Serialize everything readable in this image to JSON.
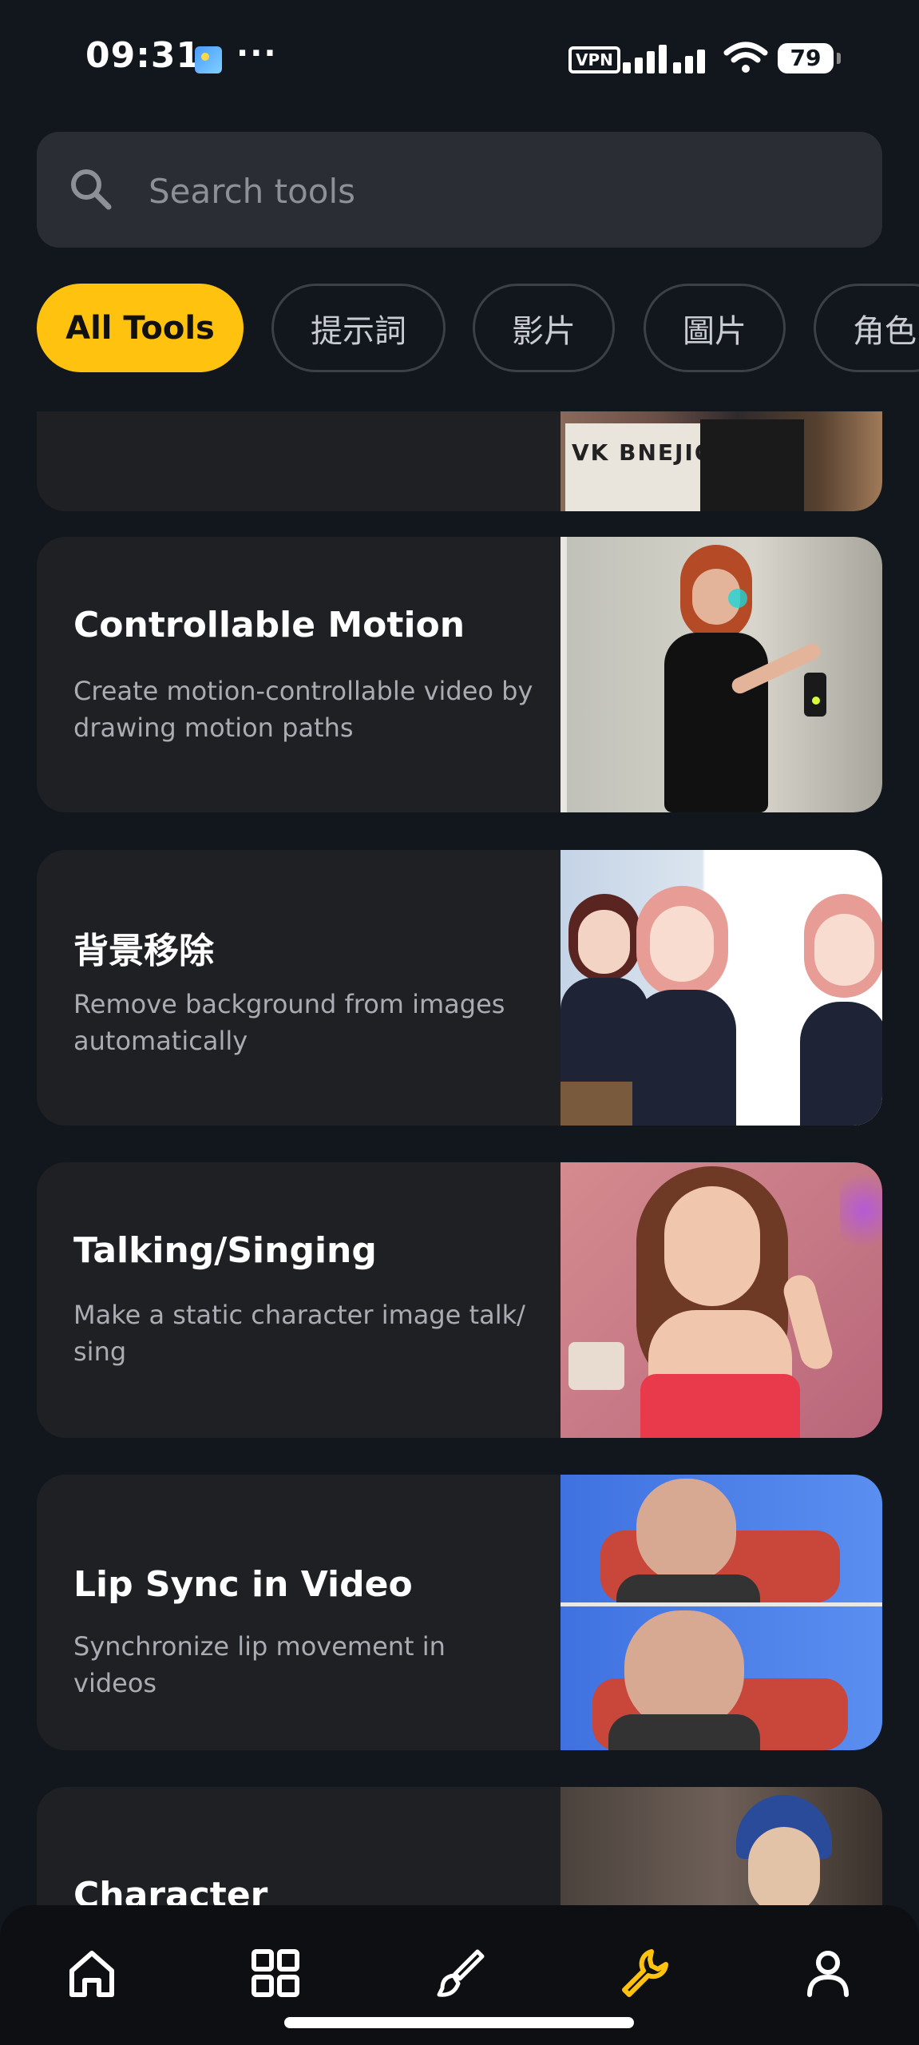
{
  "status": {
    "time": "09:31",
    "dots": "···",
    "vpn": "VPN",
    "battery": "79"
  },
  "search": {
    "placeholder": "Search tools",
    "value": ""
  },
  "chips": [
    "All Tools",
    "提示詞",
    "影片",
    "圖片",
    "角色"
  ],
  "cards": [
    {
      "title": "",
      "desc": "",
      "thumb_text": "VK BNEJION"
    },
    {
      "title": "Controllable Motion",
      "desc": "Create motion-controllable video by drawing motion paths"
    },
    {
      "title": "背景移除",
      "desc": "Remove background from images automatically"
    },
    {
      "title": "Talking/Singing",
      "desc": "Make a static character image talk/ sing"
    },
    {
      "title": "Lip Sync in Video",
      "desc": "Synchronize lip movement in videos"
    },
    {
      "title": "Character Replacement",
      "desc": ""
    }
  ],
  "nav": [
    "home-icon",
    "grid-icon",
    "brush-icon",
    "wrench-icon",
    "profile-icon"
  ],
  "colors": {
    "accent": "#ffc20e",
    "background": "#12161d",
    "card": "#1f2024"
  }
}
